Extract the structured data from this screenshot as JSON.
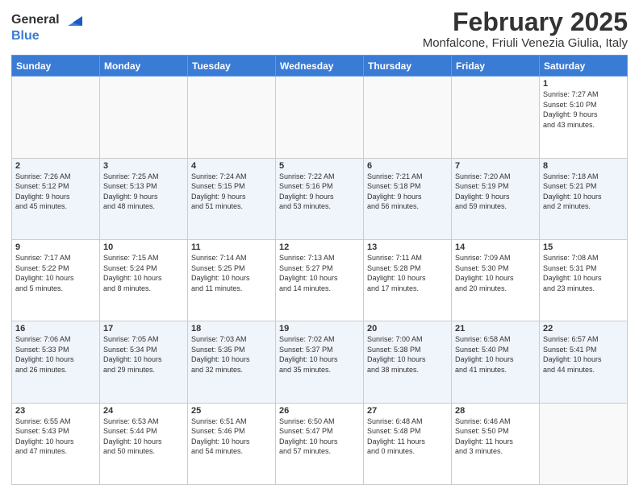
{
  "logo": {
    "general": "General",
    "blue": "Blue"
  },
  "title": "February 2025",
  "subtitle": "Monfalcone, Friuli Venezia Giulia, Italy",
  "weekdays": [
    "Sunday",
    "Monday",
    "Tuesday",
    "Wednesday",
    "Thursday",
    "Friday",
    "Saturday"
  ],
  "weeks": [
    [
      {
        "day": "",
        "info": ""
      },
      {
        "day": "",
        "info": ""
      },
      {
        "day": "",
        "info": ""
      },
      {
        "day": "",
        "info": ""
      },
      {
        "day": "",
        "info": ""
      },
      {
        "day": "",
        "info": ""
      },
      {
        "day": "1",
        "info": "Sunrise: 7:27 AM\nSunset: 5:10 PM\nDaylight: 9 hours\nand 43 minutes."
      }
    ],
    [
      {
        "day": "2",
        "info": "Sunrise: 7:26 AM\nSunset: 5:12 PM\nDaylight: 9 hours\nand 45 minutes."
      },
      {
        "day": "3",
        "info": "Sunrise: 7:25 AM\nSunset: 5:13 PM\nDaylight: 9 hours\nand 48 minutes."
      },
      {
        "day": "4",
        "info": "Sunrise: 7:24 AM\nSunset: 5:15 PM\nDaylight: 9 hours\nand 51 minutes."
      },
      {
        "day": "5",
        "info": "Sunrise: 7:22 AM\nSunset: 5:16 PM\nDaylight: 9 hours\nand 53 minutes."
      },
      {
        "day": "6",
        "info": "Sunrise: 7:21 AM\nSunset: 5:18 PM\nDaylight: 9 hours\nand 56 minutes."
      },
      {
        "day": "7",
        "info": "Sunrise: 7:20 AM\nSunset: 5:19 PM\nDaylight: 9 hours\nand 59 minutes."
      },
      {
        "day": "8",
        "info": "Sunrise: 7:18 AM\nSunset: 5:21 PM\nDaylight: 10 hours\nand 2 minutes."
      }
    ],
    [
      {
        "day": "9",
        "info": "Sunrise: 7:17 AM\nSunset: 5:22 PM\nDaylight: 10 hours\nand 5 minutes."
      },
      {
        "day": "10",
        "info": "Sunrise: 7:15 AM\nSunset: 5:24 PM\nDaylight: 10 hours\nand 8 minutes."
      },
      {
        "day": "11",
        "info": "Sunrise: 7:14 AM\nSunset: 5:25 PM\nDaylight: 10 hours\nand 11 minutes."
      },
      {
        "day": "12",
        "info": "Sunrise: 7:13 AM\nSunset: 5:27 PM\nDaylight: 10 hours\nand 14 minutes."
      },
      {
        "day": "13",
        "info": "Sunrise: 7:11 AM\nSunset: 5:28 PM\nDaylight: 10 hours\nand 17 minutes."
      },
      {
        "day": "14",
        "info": "Sunrise: 7:09 AM\nSunset: 5:30 PM\nDaylight: 10 hours\nand 20 minutes."
      },
      {
        "day": "15",
        "info": "Sunrise: 7:08 AM\nSunset: 5:31 PM\nDaylight: 10 hours\nand 23 minutes."
      }
    ],
    [
      {
        "day": "16",
        "info": "Sunrise: 7:06 AM\nSunset: 5:33 PM\nDaylight: 10 hours\nand 26 minutes."
      },
      {
        "day": "17",
        "info": "Sunrise: 7:05 AM\nSunset: 5:34 PM\nDaylight: 10 hours\nand 29 minutes."
      },
      {
        "day": "18",
        "info": "Sunrise: 7:03 AM\nSunset: 5:35 PM\nDaylight: 10 hours\nand 32 minutes."
      },
      {
        "day": "19",
        "info": "Sunrise: 7:02 AM\nSunset: 5:37 PM\nDaylight: 10 hours\nand 35 minutes."
      },
      {
        "day": "20",
        "info": "Sunrise: 7:00 AM\nSunset: 5:38 PM\nDaylight: 10 hours\nand 38 minutes."
      },
      {
        "day": "21",
        "info": "Sunrise: 6:58 AM\nSunset: 5:40 PM\nDaylight: 10 hours\nand 41 minutes."
      },
      {
        "day": "22",
        "info": "Sunrise: 6:57 AM\nSunset: 5:41 PM\nDaylight: 10 hours\nand 44 minutes."
      }
    ],
    [
      {
        "day": "23",
        "info": "Sunrise: 6:55 AM\nSunset: 5:43 PM\nDaylight: 10 hours\nand 47 minutes."
      },
      {
        "day": "24",
        "info": "Sunrise: 6:53 AM\nSunset: 5:44 PM\nDaylight: 10 hours\nand 50 minutes."
      },
      {
        "day": "25",
        "info": "Sunrise: 6:51 AM\nSunset: 5:46 PM\nDaylight: 10 hours\nand 54 minutes."
      },
      {
        "day": "26",
        "info": "Sunrise: 6:50 AM\nSunset: 5:47 PM\nDaylight: 10 hours\nand 57 minutes."
      },
      {
        "day": "27",
        "info": "Sunrise: 6:48 AM\nSunset: 5:48 PM\nDaylight: 11 hours\nand 0 minutes."
      },
      {
        "day": "28",
        "info": "Sunrise: 6:46 AM\nSunset: 5:50 PM\nDaylight: 11 hours\nand 3 minutes."
      },
      {
        "day": "",
        "info": ""
      }
    ]
  ]
}
